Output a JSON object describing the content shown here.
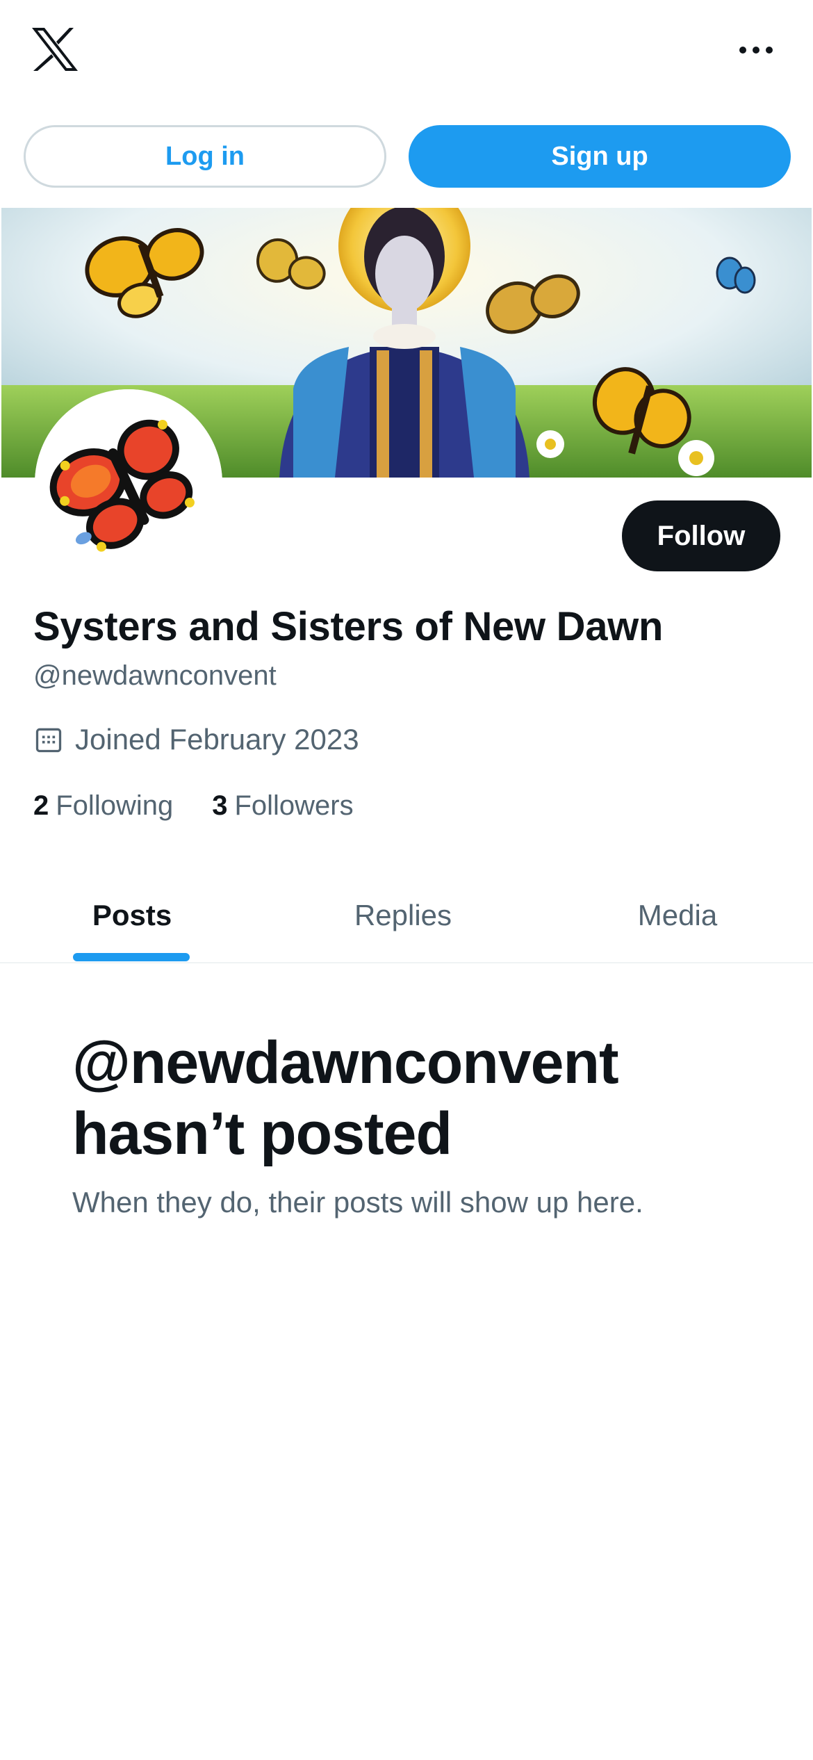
{
  "header": {
    "logo_icon": "x-logo-icon",
    "more_icon": "more-icon"
  },
  "auth": {
    "login_label": "Log in",
    "signup_label": "Sign up"
  },
  "profile": {
    "name": "Systers and Sisters of New Dawn",
    "handle": "@newdawnconvent",
    "joined": "Joined February 2023",
    "follow_label": "Follow",
    "following_count": "2",
    "following_label": "Following",
    "followers_count": "3",
    "followers_label": "Followers"
  },
  "tabs": [
    {
      "label": "Posts",
      "active": true
    },
    {
      "label": "Replies",
      "active": false
    },
    {
      "label": "Media",
      "active": false
    }
  ],
  "empty_state": {
    "title": "@newdawnconvent hasn’t posted",
    "subtitle": "When they do, their posts will show up here."
  },
  "colors": {
    "accent": "#1d9bf0",
    "text_primary": "#0f1419",
    "text_secondary": "#536471",
    "border": "#cfd9de"
  }
}
